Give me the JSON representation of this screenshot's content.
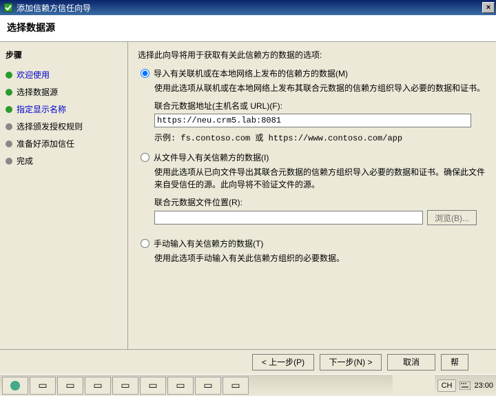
{
  "window": {
    "title": "添加信赖方信任向导",
    "close_label": "×"
  },
  "header": {
    "title": "选择数据源"
  },
  "sidebar": {
    "heading": "步骤",
    "items": [
      {
        "label": "欢迎使用",
        "state": "link"
      },
      {
        "label": "选择数据源",
        "state": "link"
      },
      {
        "label": "指定显示名称",
        "state": "link"
      },
      {
        "label": "选择颁发授权规则",
        "state": "pending"
      },
      {
        "label": "准备好添加信任",
        "state": "pending"
      },
      {
        "label": "完成",
        "state": "pending"
      }
    ]
  },
  "main": {
    "intro": "选择此向导将用于获取有关此信赖方的数据的选项:",
    "opt1": {
      "label": "导入有关联机或在本地网络上发布的信赖方的数据(M)",
      "desc": "使用此选项从联机或在本地网络上发布其联合元数据的信赖方组织导入必要的数据和证书。",
      "field_label": "联合元数据地址(主机名或 URL)(F):",
      "value": "https://neu.crm5.lab:8081",
      "hint": "示例: fs.contoso.com 或 https://www.contoso.com/app"
    },
    "opt2": {
      "label": "从文件导入有关信赖方的数据(I)",
      "desc": "使用此选项从已向文件导出其联合元数据的信赖方组织导入必要的数据和证书。确保此文件来自受信任的源。此向导将不验证文件的源。",
      "field_label": "联合元数据文件位置(R):",
      "value": "",
      "browse": "浏览(B)..."
    },
    "opt3": {
      "label": "手动输入有关信赖方的数据(T)",
      "desc": "使用此选项手动输入有关此信赖方组织的必要数据。"
    }
  },
  "buttons": {
    "prev": "< 上一步(P)",
    "next": "下一步(N) >",
    "cancel": "取消",
    "help": "帮"
  },
  "tray": {
    "ime": "CH",
    "clock": "23:00"
  }
}
